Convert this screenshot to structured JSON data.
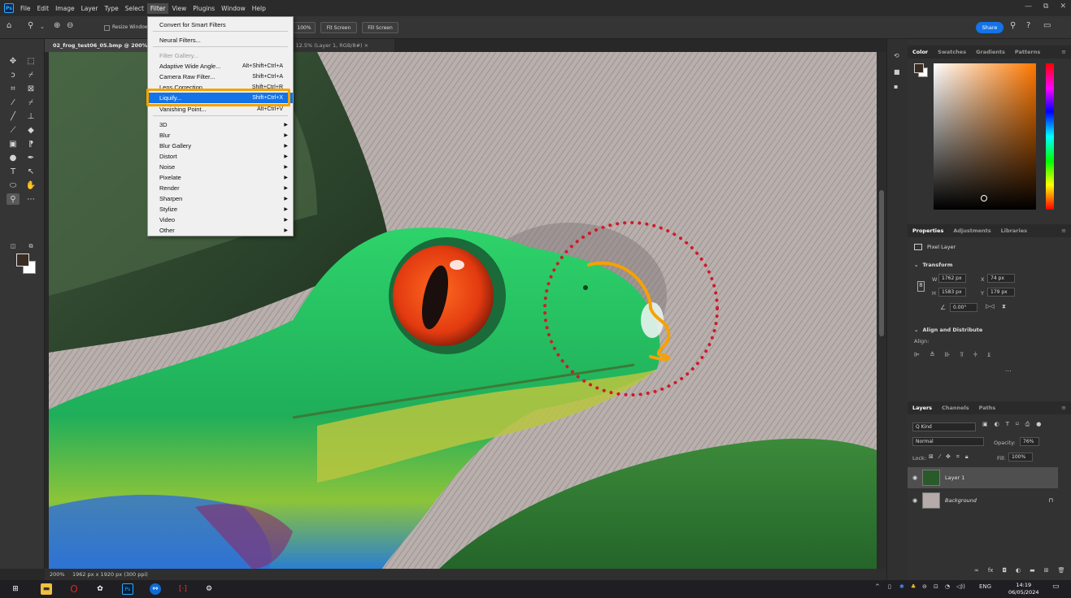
{
  "app": {
    "menu": [
      "File",
      "Edit",
      "Image",
      "Layer",
      "Type",
      "Select",
      "Filter",
      "View",
      "Plugins",
      "Window",
      "Help"
    ],
    "logo": "Ps",
    "window_controls": [
      "—",
      "⧉",
      "✕"
    ]
  },
  "options_bar": {
    "resize_windows": "Resize Windows",
    "btn_100": "100%",
    "fit_screen": "Fit Screen",
    "fill_screen": "Fill Screen",
    "share": "Share"
  },
  "tabs": [
    {
      "label": "02_frog_test06_05.bmp @ 200% (",
      "active": true
    },
    {
      "label": "@ 12.5% (Layer 1, RGB/8#)  ×",
      "active": false
    }
  ],
  "filter_menu": {
    "items": [
      {
        "label": "Convert for Smart Filters",
        "shortcut": "",
        "submenu": false,
        "disabled": false
      },
      {
        "label": "Neural Filters...",
        "shortcut": "",
        "submenu": false,
        "disabled": false
      },
      {
        "label": "Filter Gallery...",
        "shortcut": "",
        "submenu": false,
        "disabled": true
      },
      {
        "label": "Adaptive Wide Angle...",
        "shortcut": "Alt+Shift+Ctrl+A",
        "submenu": false,
        "disabled": false
      },
      {
        "label": "Camera Raw Filter...",
        "shortcut": "Shift+Ctrl+A",
        "submenu": false,
        "disabled": false
      },
      {
        "label": "Lens Correction...",
        "shortcut": "Shift+Ctrl+R",
        "submenu": false,
        "disabled": false
      },
      {
        "label": "Liquify...",
        "shortcut": "Shift+Ctrl+X",
        "submenu": false,
        "disabled": false,
        "highlighted": true
      },
      {
        "label": "Vanishing Point...",
        "shortcut": "Alt+Ctrl+V",
        "submenu": false,
        "disabled": false
      },
      {
        "label": "3D",
        "shortcut": "",
        "submenu": true,
        "disabled": false
      },
      {
        "label": "Blur",
        "shortcut": "",
        "submenu": true,
        "disabled": false
      },
      {
        "label": "Blur Gallery",
        "shortcut": "",
        "submenu": true,
        "disabled": false
      },
      {
        "label": "Distort",
        "shortcut": "",
        "submenu": true,
        "disabled": false
      },
      {
        "label": "Noise",
        "shortcut": "",
        "submenu": true,
        "disabled": false
      },
      {
        "label": "Pixelate",
        "shortcut": "",
        "submenu": true,
        "disabled": false
      },
      {
        "label": "Render",
        "shortcut": "",
        "submenu": true,
        "disabled": false
      },
      {
        "label": "Sharpen",
        "shortcut": "",
        "submenu": true,
        "disabled": false
      },
      {
        "label": "Stylize",
        "shortcut": "",
        "submenu": true,
        "disabled": false
      },
      {
        "label": "Video",
        "shortcut": "",
        "submenu": true,
        "disabled": false
      },
      {
        "label": "Other",
        "shortcut": "",
        "submenu": true,
        "disabled": false
      }
    ]
  },
  "status": {
    "zoom": "200%",
    "doc_info": "1962 px x 1920 px (300 ppi)"
  },
  "color_panel": {
    "tabs": [
      "Color",
      "Swatches",
      "Gradients",
      "Patterns"
    ],
    "foreground": "#3a2c22",
    "background": "#ffffff"
  },
  "properties_panel": {
    "tabs": [
      "Properties",
      "Adjustments",
      "Libraries"
    ],
    "layer_type": "Pixel Layer",
    "transform_title": "Transform",
    "w_label": "W",
    "w_value": "1762 px",
    "x_label": "X",
    "x_value": "74 px",
    "h_label": "H",
    "h_value": "1583 px",
    "y_label": "Y",
    "y_value": "179 px",
    "angle_value": "0.00°",
    "align_title": "Align and Distribute",
    "align_label": "Align:",
    "more": "..."
  },
  "layers_panel": {
    "tabs": [
      "Layers",
      "Channels",
      "Paths"
    ],
    "kind": "Q Kind",
    "blend_mode": "Normal",
    "opacity_label": "Opacity:",
    "opacity_value": "76%",
    "lock_label": "Lock:",
    "fill_label": "Fill:",
    "fill_value": "100%",
    "layers": [
      {
        "name": "Layer 1",
        "selected": true
      },
      {
        "name": "Background",
        "selected": false
      }
    ]
  },
  "taskbar": {
    "lang": "ENG",
    "time": "14:19",
    "date": "06/05/2024"
  }
}
